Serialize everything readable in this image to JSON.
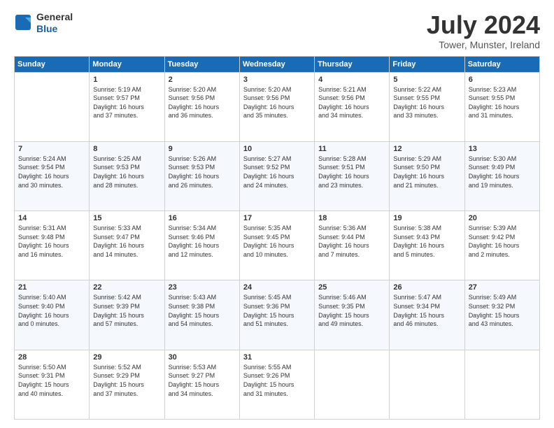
{
  "logo": {
    "general": "General",
    "blue": "Blue"
  },
  "header": {
    "month": "July 2024",
    "location": "Tower, Munster, Ireland"
  },
  "columns": [
    "Sunday",
    "Monday",
    "Tuesday",
    "Wednesday",
    "Thursday",
    "Friday",
    "Saturday"
  ],
  "weeks": [
    [
      {
        "day": "",
        "info": ""
      },
      {
        "day": "1",
        "info": "Sunrise: 5:19 AM\nSunset: 9:57 PM\nDaylight: 16 hours\nand 37 minutes."
      },
      {
        "day": "2",
        "info": "Sunrise: 5:20 AM\nSunset: 9:56 PM\nDaylight: 16 hours\nand 36 minutes."
      },
      {
        "day": "3",
        "info": "Sunrise: 5:20 AM\nSunset: 9:56 PM\nDaylight: 16 hours\nand 35 minutes."
      },
      {
        "day": "4",
        "info": "Sunrise: 5:21 AM\nSunset: 9:56 PM\nDaylight: 16 hours\nand 34 minutes."
      },
      {
        "day": "5",
        "info": "Sunrise: 5:22 AM\nSunset: 9:55 PM\nDaylight: 16 hours\nand 33 minutes."
      },
      {
        "day": "6",
        "info": "Sunrise: 5:23 AM\nSunset: 9:55 PM\nDaylight: 16 hours\nand 31 minutes."
      }
    ],
    [
      {
        "day": "7",
        "info": "Sunrise: 5:24 AM\nSunset: 9:54 PM\nDaylight: 16 hours\nand 30 minutes."
      },
      {
        "day": "8",
        "info": "Sunrise: 5:25 AM\nSunset: 9:53 PM\nDaylight: 16 hours\nand 28 minutes."
      },
      {
        "day": "9",
        "info": "Sunrise: 5:26 AM\nSunset: 9:53 PM\nDaylight: 16 hours\nand 26 minutes."
      },
      {
        "day": "10",
        "info": "Sunrise: 5:27 AM\nSunset: 9:52 PM\nDaylight: 16 hours\nand 24 minutes."
      },
      {
        "day": "11",
        "info": "Sunrise: 5:28 AM\nSunset: 9:51 PM\nDaylight: 16 hours\nand 23 minutes."
      },
      {
        "day": "12",
        "info": "Sunrise: 5:29 AM\nSunset: 9:50 PM\nDaylight: 16 hours\nand 21 minutes."
      },
      {
        "day": "13",
        "info": "Sunrise: 5:30 AM\nSunset: 9:49 PM\nDaylight: 16 hours\nand 19 minutes."
      }
    ],
    [
      {
        "day": "14",
        "info": "Sunrise: 5:31 AM\nSunset: 9:48 PM\nDaylight: 16 hours\nand 16 minutes."
      },
      {
        "day": "15",
        "info": "Sunrise: 5:33 AM\nSunset: 9:47 PM\nDaylight: 16 hours\nand 14 minutes."
      },
      {
        "day": "16",
        "info": "Sunrise: 5:34 AM\nSunset: 9:46 PM\nDaylight: 16 hours\nand 12 minutes."
      },
      {
        "day": "17",
        "info": "Sunrise: 5:35 AM\nSunset: 9:45 PM\nDaylight: 16 hours\nand 10 minutes."
      },
      {
        "day": "18",
        "info": "Sunrise: 5:36 AM\nSunset: 9:44 PM\nDaylight: 16 hours\nand 7 minutes."
      },
      {
        "day": "19",
        "info": "Sunrise: 5:38 AM\nSunset: 9:43 PM\nDaylight: 16 hours\nand 5 minutes."
      },
      {
        "day": "20",
        "info": "Sunrise: 5:39 AM\nSunset: 9:42 PM\nDaylight: 16 hours\nand 2 minutes."
      }
    ],
    [
      {
        "day": "21",
        "info": "Sunrise: 5:40 AM\nSunset: 9:40 PM\nDaylight: 16 hours\nand 0 minutes."
      },
      {
        "day": "22",
        "info": "Sunrise: 5:42 AM\nSunset: 9:39 PM\nDaylight: 15 hours\nand 57 minutes."
      },
      {
        "day": "23",
        "info": "Sunrise: 5:43 AM\nSunset: 9:38 PM\nDaylight: 15 hours\nand 54 minutes."
      },
      {
        "day": "24",
        "info": "Sunrise: 5:45 AM\nSunset: 9:36 PM\nDaylight: 15 hours\nand 51 minutes."
      },
      {
        "day": "25",
        "info": "Sunrise: 5:46 AM\nSunset: 9:35 PM\nDaylight: 15 hours\nand 49 minutes."
      },
      {
        "day": "26",
        "info": "Sunrise: 5:47 AM\nSunset: 9:34 PM\nDaylight: 15 hours\nand 46 minutes."
      },
      {
        "day": "27",
        "info": "Sunrise: 5:49 AM\nSunset: 9:32 PM\nDaylight: 15 hours\nand 43 minutes."
      }
    ],
    [
      {
        "day": "28",
        "info": "Sunrise: 5:50 AM\nSunset: 9:31 PM\nDaylight: 15 hours\nand 40 minutes."
      },
      {
        "day": "29",
        "info": "Sunrise: 5:52 AM\nSunset: 9:29 PM\nDaylight: 15 hours\nand 37 minutes."
      },
      {
        "day": "30",
        "info": "Sunrise: 5:53 AM\nSunset: 9:27 PM\nDaylight: 15 hours\nand 34 minutes."
      },
      {
        "day": "31",
        "info": "Sunrise: 5:55 AM\nSunset: 9:26 PM\nDaylight: 15 hours\nand 31 minutes."
      },
      {
        "day": "",
        "info": ""
      },
      {
        "day": "",
        "info": ""
      },
      {
        "day": "",
        "info": ""
      }
    ]
  ]
}
